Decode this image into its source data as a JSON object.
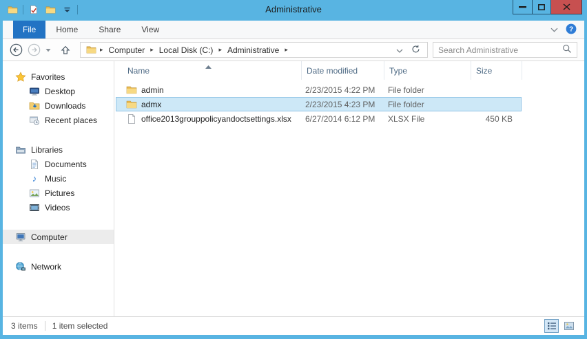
{
  "titlebar": {
    "title": "Administrative"
  },
  "tabs": {
    "file": "File",
    "home": "Home",
    "share": "Share",
    "view": "View"
  },
  "address": {
    "crumbs": {
      "c0": "Computer",
      "c1": "Local Disk (C:)",
      "c2": "Administrative"
    }
  },
  "search": {
    "placeholder": "Search Administrative"
  },
  "columns": {
    "name": "Name",
    "date": "Date modified",
    "type": "Type",
    "size": "Size"
  },
  "files": [
    {
      "name": "admin",
      "date": "2/23/2015 4:22 PM",
      "type": "File folder",
      "size": "",
      "icon": "folder",
      "selected": false
    },
    {
      "name": "admx",
      "date": "2/23/2015 4:23 PM",
      "type": "File folder",
      "size": "",
      "icon": "folder",
      "selected": true
    },
    {
      "name": "office2013grouppolicyandoctsettings.xlsx",
      "date": "6/27/2014 6:12 PM",
      "type": "XLSX File",
      "size": "450 KB",
      "icon": "file",
      "selected": false
    }
  ],
  "sidebar": {
    "favorites": "Favorites",
    "desktop": "Desktop",
    "downloads": "Downloads",
    "recent": "Recent places",
    "libraries": "Libraries",
    "documents": "Documents",
    "music": "Music",
    "pictures": "Pictures",
    "videos": "Videos",
    "computer": "Computer",
    "network": "Network"
  },
  "status": {
    "count": "3 items",
    "selected": "1 item selected"
  },
  "icons": {
    "crumb_sep": "▸",
    "music_note": "♪",
    "help_mark": "?"
  },
  "colors": {
    "titlebar_blue": "#58b4e2",
    "file_tab_blue": "#2273c4",
    "close_red": "#c75050",
    "selection_fill": "#cde8f7",
    "selection_border": "#92c4e6",
    "header_text": "#4f6b85"
  }
}
